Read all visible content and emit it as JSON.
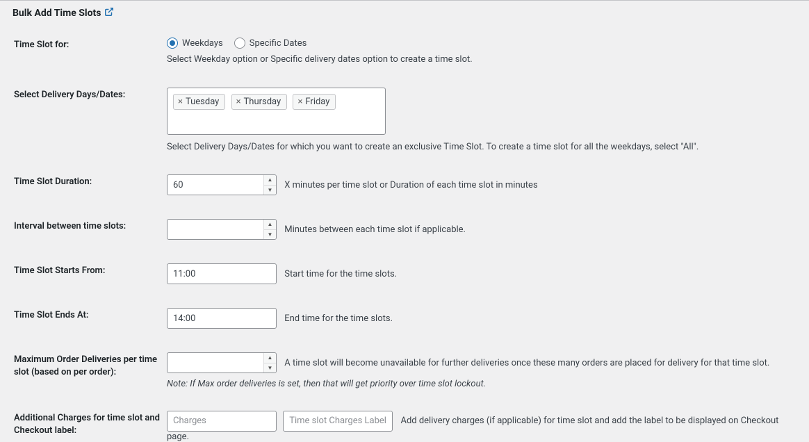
{
  "section_title": "Bulk Add Time Slots",
  "rows": {
    "slot_for": {
      "label": "Time Slot for:",
      "options": {
        "weekdays": "Weekdays",
        "specific": "Specific Dates"
      },
      "help": "Select Weekday option or Specific delivery dates option to create a time slot."
    },
    "select_days": {
      "label": "Select Delivery Days/Dates:",
      "tags": [
        "Tuesday",
        "Thursday",
        "Friday"
      ],
      "help": "Select Delivery Days/Dates for which you want to create an exclusive Time Slot. To create a time slot for all the weekdays, select \"All\"."
    },
    "duration": {
      "label": "Time Slot Duration:",
      "value": "60",
      "help": "X minutes per time slot or Duration of each time slot in minutes"
    },
    "interval": {
      "label": "Interval between time slots:",
      "value": "",
      "help": "Minutes between each time slot if applicable."
    },
    "start": {
      "label": "Time Slot Starts From:",
      "value": "11:00",
      "help": "Start time for the time slots."
    },
    "end": {
      "label": "Time Slot Ends At:",
      "value": "14:00",
      "help": "End time for the time slots."
    },
    "max": {
      "label": "Maximum Order Deliveries per time slot (based on per order):",
      "value": "",
      "help": "A time slot will become unavailable for further deliveries once these many orders are placed for delivery for that time slot.",
      "note": "Note: If Max order deliveries is set, then that will get priority over time slot lockout."
    },
    "charges": {
      "label": "Additional Charges for time slot and Checkout label:",
      "placeholder1": "Charges",
      "placeholder2": "Time slot Charges Label",
      "help": "Add delivery charges (if applicable) for time slot and add the label to be displayed on Checkout page."
    }
  }
}
